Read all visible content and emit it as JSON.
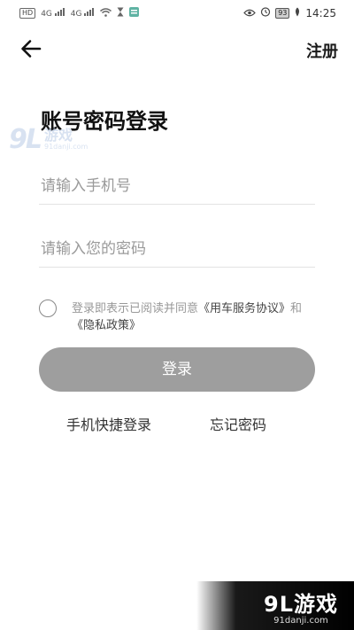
{
  "status_bar": {
    "left_items": [
      "HD",
      "4G",
      "4G"
    ],
    "battery": "93",
    "time": "14:25"
  },
  "header": {
    "back_icon": "arrow-left-icon",
    "register_label": "注册"
  },
  "main": {
    "title": "账号密码登录",
    "phone_placeholder": "请输入手机号",
    "password_placeholder": "请输入您的密码",
    "agreement": {
      "prefix": "登录即表示已阅读并同意",
      "terms_link": "《用车服务协议》",
      "and": "和",
      "privacy_link": "《隐私政策》"
    },
    "login_label": "登录",
    "quick_login_label": "手机快捷登录",
    "forgot_password_label": "忘记密码"
  },
  "watermark": {
    "logo": "9L",
    "name": "游戏",
    "url": "91danji.com"
  },
  "colors": {
    "login_button": "#9e9e9e",
    "text_dark": "#1a1a1a",
    "placeholder": "#9a9a9a"
  }
}
